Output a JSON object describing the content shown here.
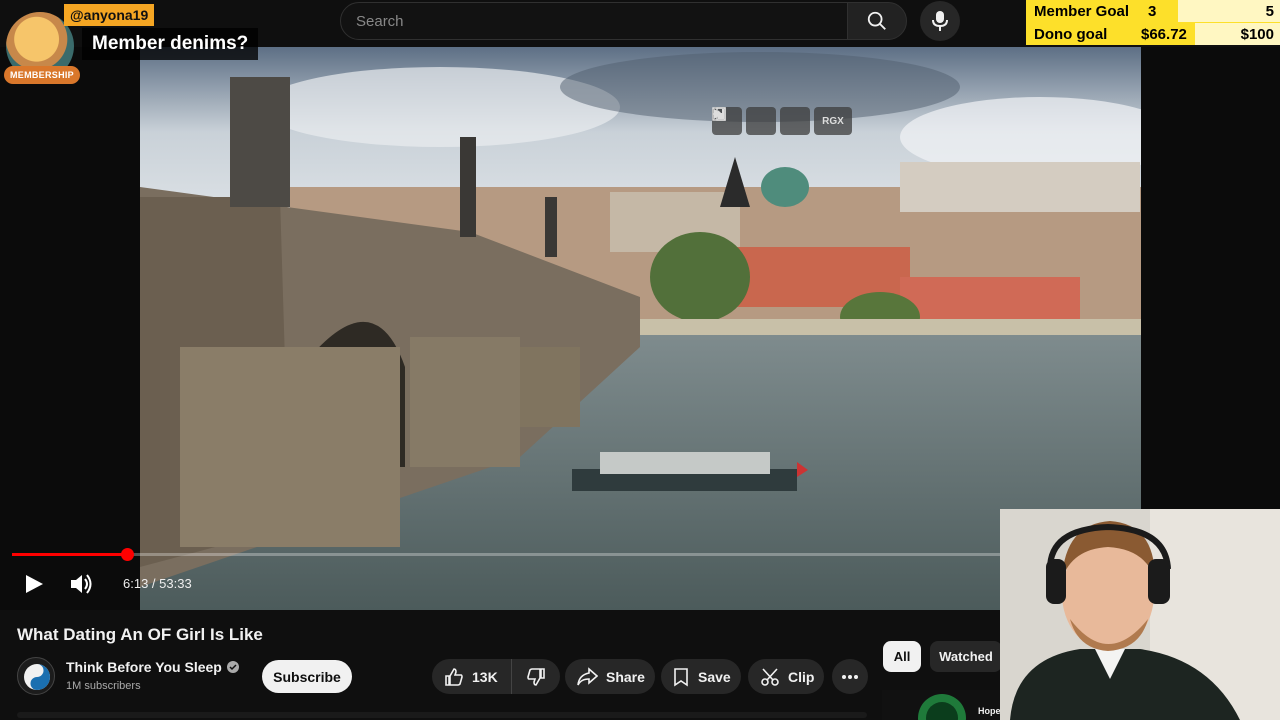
{
  "search": {
    "placeholder": "Search"
  },
  "overlay": {
    "member_handle": "@anyona19",
    "member_message": "Member denims?",
    "member_badge": "MEMBERSHIP",
    "goals": [
      {
        "label": "Member Goal",
        "current": "3",
        "target": "5",
        "fraction": 0.6
      },
      {
        "label": "Dono goal",
        "current": "$66.72",
        "target": "$100",
        "fraction": 0.6672
      }
    ]
  },
  "player": {
    "top_controls": [
      "miniplayer-icon",
      "exit-icon",
      "next-icon",
      "RGX"
    ],
    "time_current": "6:13",
    "time_separator": " / ",
    "time_total": "53:33",
    "progress": 0.1161
  },
  "video": {
    "title": "What Dating An OF Girl Is Like",
    "channel": "Think Before You Sleep",
    "subscribers": "1M subscribers",
    "subscribe_label": "Subscribe",
    "likes": "13K",
    "share_label": "Share",
    "save_label": "Save",
    "clip_label": "Clip"
  },
  "chips": {
    "all": "All",
    "watched": "Watched"
  },
  "rec": {
    "partial_text": "Hope"
  },
  "colors": {
    "accent": "#ff0000",
    "goal_bar": "#fde02a",
    "handle_bg": "#f5a623"
  }
}
